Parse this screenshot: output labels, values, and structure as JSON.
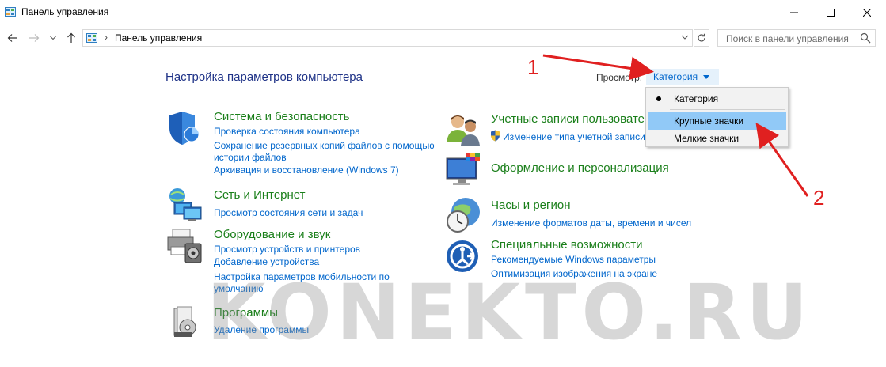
{
  "window": {
    "title": "Панель управления"
  },
  "address": {
    "path": "Панель управления",
    "separator": "›"
  },
  "search": {
    "placeholder": "Поиск в панели управления"
  },
  "page": {
    "title": "Настройка параметров компьютера"
  },
  "view": {
    "label": "Просмотр:",
    "selected": "Категория"
  },
  "dropdown": {
    "options": [
      "Категория",
      "Крупные значки",
      "Мелкие значки"
    ],
    "selected_index": 0,
    "highlighted_index": 1
  },
  "categories": {
    "system": {
      "title": "Система и безопасность",
      "links": [
        "Проверка состояния компьютера",
        "Сохранение резервных копий файлов с помощью",
        "истории файлов",
        "Архивация и восстановление (Windows 7)"
      ]
    },
    "network": {
      "title": "Сеть и Интернет",
      "links": [
        "Просмотр состояния сети и задач"
      ]
    },
    "hardware": {
      "title": "Оборудование и звук",
      "links": [
        "Просмотр устройств и принтеров",
        "Добавление устройства",
        "Настройка параметров мобильности по",
        "умолчанию"
      ]
    },
    "programs": {
      "title": "Программы",
      "links": [
        "Удаление программы"
      ]
    },
    "users": {
      "title": "Учетные записи пользовате",
      "links": [
        "Изменение типа учетной записи"
      ]
    },
    "appearance": {
      "title": "Оформление и персонализация",
      "links": []
    },
    "clock": {
      "title": "Часы и регион",
      "links": [
        "Изменение форматов даты, времени и чисел"
      ]
    },
    "ease": {
      "title": "Специальные возможности",
      "links": [
        "Рекомендуемые Windows параметры",
        "Оптимизация изображения на экране"
      ]
    }
  },
  "annotations": {
    "marker1": "1",
    "marker2": "2",
    "color": "#e02020"
  },
  "watermark": "KONEKTO.RU",
  "colors": {
    "link": "#0066cc",
    "category_heading": "#1a7f1a",
    "page_title": "#1e3287",
    "menu_highlight": "#91c9f7"
  }
}
